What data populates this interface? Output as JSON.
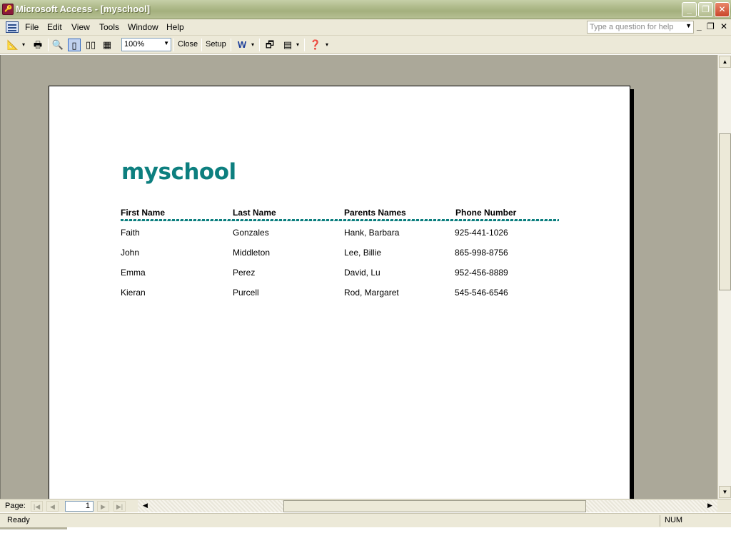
{
  "window": {
    "title": "Microsoft Access - [myschool]"
  },
  "menu": {
    "items": [
      {
        "label": "File"
      },
      {
        "label": "Edit"
      },
      {
        "label": "View"
      },
      {
        "label": "Tools"
      },
      {
        "label": "Window"
      },
      {
        "label": "Help"
      }
    ],
    "help_placeholder": "Type a question for help"
  },
  "toolbar": {
    "zoom": "100%",
    "close_label": "Close",
    "setup_label": "Setup"
  },
  "report": {
    "title": "myschool",
    "columns": [
      "First Name",
      "Last Name",
      "Parents Names",
      "Phone Number"
    ],
    "rows": [
      [
        "Faith",
        "Gonzales",
        "Hank, Barbara",
        "925-441-1026"
      ],
      [
        "John",
        "Middleton",
        "Lee, Billie",
        "865-998-8756"
      ],
      [
        "Emma",
        "Perez",
        "David, Lu",
        "952-456-8889"
      ],
      [
        "Kieran",
        "Purcell",
        "Rod, Margaret",
        "545-546-6546"
      ]
    ],
    "accent_color": "#0d7f7f"
  },
  "navigation": {
    "page_label": "Page:",
    "page_number": "1"
  },
  "status": {
    "text": "Ready",
    "num_indicator": "NUM"
  }
}
